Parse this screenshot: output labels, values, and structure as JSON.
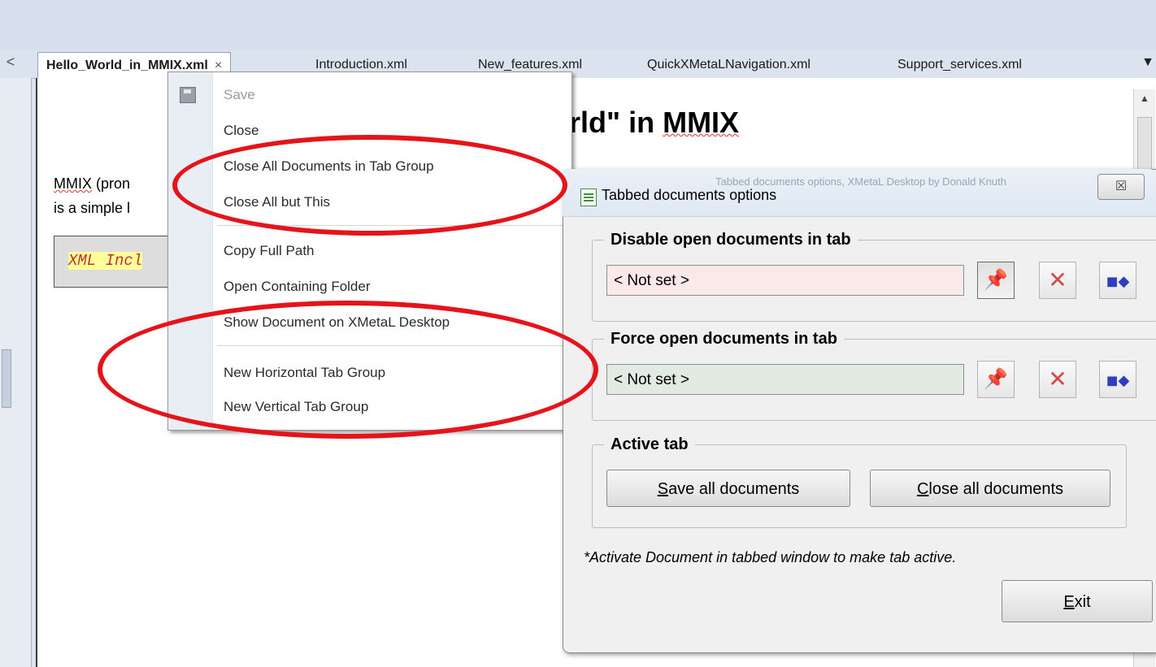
{
  "tabs": {
    "items": [
      {
        "label": "Hello_World_in_MMIX.xml",
        "close": "×"
      },
      {
        "label": "Introduction.xml"
      },
      {
        "label": "New_features.xml"
      },
      {
        "label": "QuickXMetaLNavigation.xml"
      },
      {
        "label": "Support_services.xml"
      }
    ],
    "overflow_icon": "▼",
    "scroll_left_icon": "<"
  },
  "document": {
    "title_prefix": "rld\" in ",
    "title_word": "MMIX",
    "para1_word": "MMIX",
    "para1_rest": " (pron",
    "para2": "is a simple l",
    "xml_include": "XML Incl"
  },
  "context_menu": {
    "items": [
      {
        "label": "Save",
        "enabled": false,
        "icon": "save-icon"
      },
      {
        "label": "Close"
      },
      {
        "label": "Close All Documents in Tab Group"
      },
      {
        "label": "Close All but This"
      },
      {
        "label": "Copy Full Path"
      },
      {
        "label": "Open Containing Folder"
      },
      {
        "label": "Show Document on XMetaL Desktop"
      },
      {
        "label": "New Horizontal Tab Group"
      },
      {
        "label": "New Vertical Tab Group"
      }
    ]
  },
  "dialog": {
    "title": "Tabbed documents options",
    "close_glyph": "☒",
    "ghost_text": "Tabbed documents options, XMetaL Desktop by Donald Knuth",
    "disable_group": {
      "legend": "Disable open documents in tab",
      "value": "< Not set >"
    },
    "force_group": {
      "legend": "Force open documents in tab",
      "value": "< Not set >"
    },
    "active_group": {
      "legend": "Active tab",
      "save_all_first": "S",
      "save_all_rest": "ave all documents",
      "close_all_first": "C",
      "close_all_rest": "lose all documents"
    },
    "note": "*Activate Document in tabbed window to make tab active.",
    "exit_first": "E",
    "exit_rest": "xit",
    "icons": {
      "pin": "pin-icon",
      "clear": "clear-x-icon",
      "pick": "pick-tab-icon"
    },
    "glyphs": {
      "pin": "📌",
      "clear": "✕",
      "pick": "◼◆"
    }
  },
  "colors": {
    "annotation_red": "#e5141b",
    "disable_input_bg": "#fbe8e8",
    "force_input_bg": "#e2ebe2"
  }
}
